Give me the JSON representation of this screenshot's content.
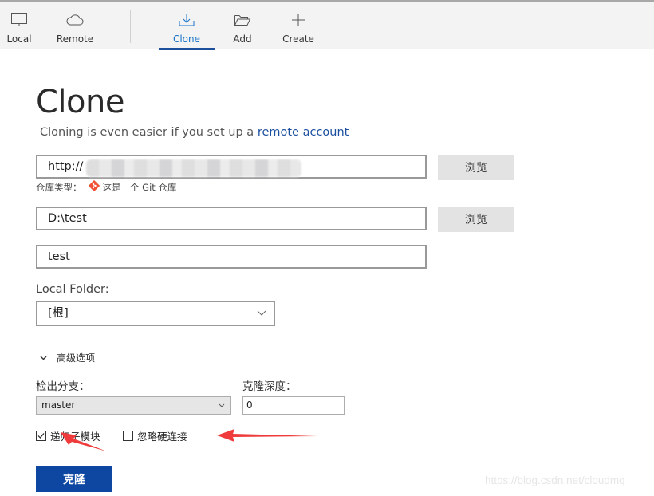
{
  "toolbar": {
    "items": [
      {
        "label": "Local",
        "icon": "monitor-icon"
      },
      {
        "label": "Remote",
        "icon": "cloud-icon"
      },
      {
        "label": "Clone",
        "icon": "download-icon",
        "active": true
      },
      {
        "label": "Add",
        "icon": "folder-open-icon"
      },
      {
        "label": "Create",
        "icon": "plus-icon"
      }
    ],
    "accent": "#1e4f9c"
  },
  "page": {
    "title": "Clone",
    "subtitle_prefix": "Cloning is even easier if you set up a ",
    "subtitle_link": "remote account"
  },
  "form": {
    "source_url": "http://",
    "browse_label": "浏览",
    "repo_type_label": "仓库类型：",
    "repo_type_value": "这是一个 Git 仓库",
    "destination_path": "D:\\test",
    "name": "test",
    "local_folder_label": "Local Folder:",
    "local_folder_value": "[根]",
    "advanced_label": "高级选项",
    "branch_label": "检出分支：",
    "branch_value": "master",
    "depth_label": "克隆深度：",
    "depth_value": "0",
    "recurse_submodules_label": "递归子模块",
    "recurse_submodules_checked": true,
    "ignore_hardlinks_label": "忽略硬连接",
    "ignore_hardlinks_checked": false,
    "clone_button": "克隆"
  },
  "colors": {
    "primary_button": "#0d47a1",
    "link": "#1c4fa0",
    "annotation_arrow": "#ef3b3b",
    "git_icon": "#f05033"
  },
  "watermark": "https://blog.csdn.net/cloudmq"
}
